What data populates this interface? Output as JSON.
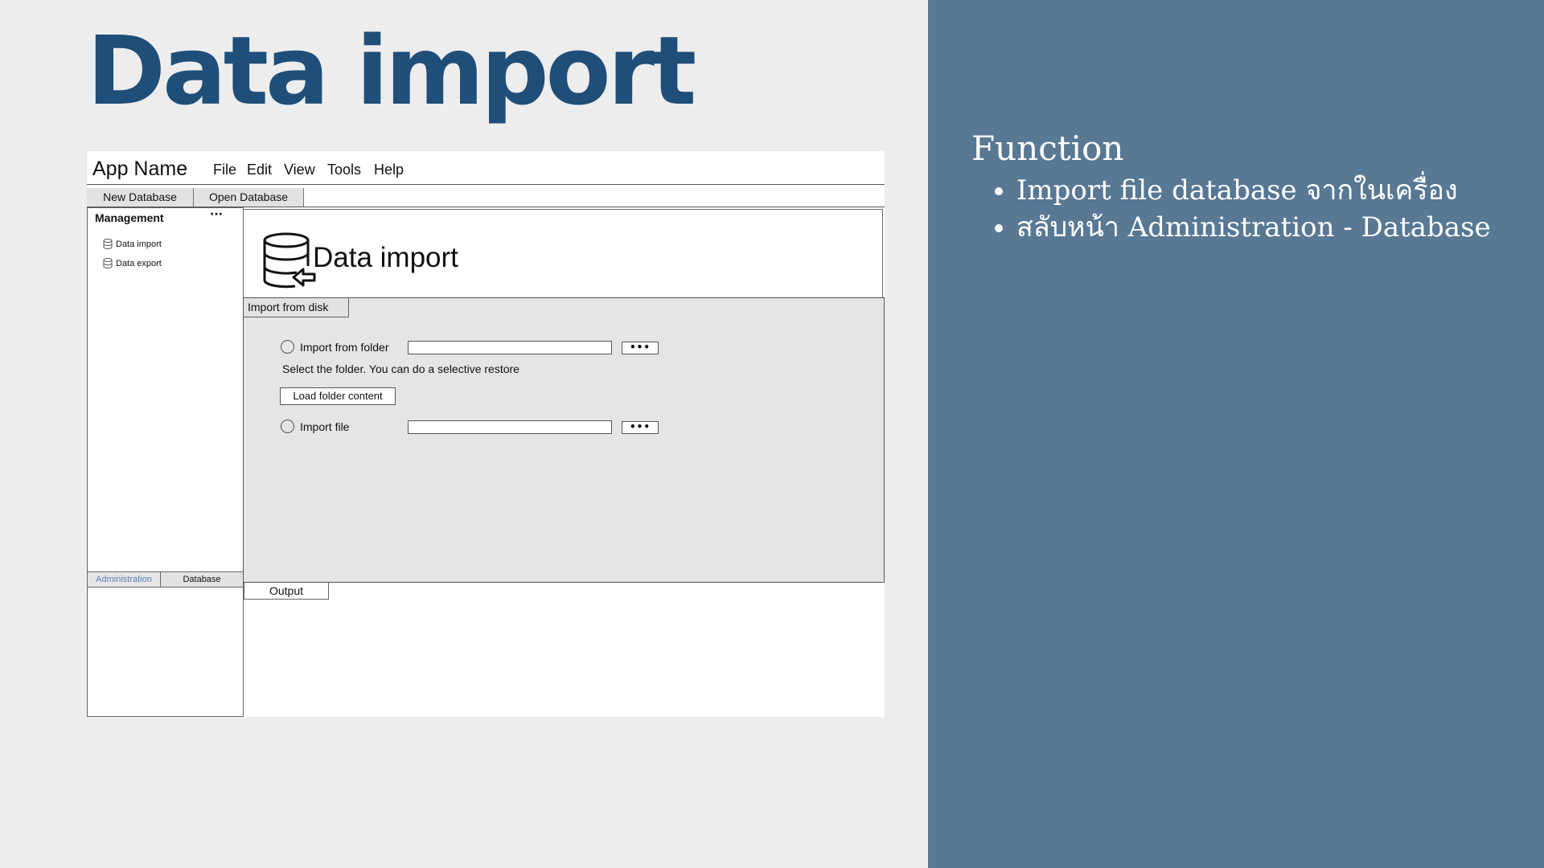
{
  "slide": {
    "title": "Data import",
    "function_title": "Function",
    "function_items": [
      "Import file database จากในเครื่อง",
      "สลับหน้า Administration - Database"
    ]
  },
  "app": {
    "name": "App Name",
    "menu": [
      "File",
      "Edit",
      "View",
      "Tools",
      "Help"
    ],
    "toolbar": [
      "New Database",
      "Open Database"
    ]
  },
  "sidebar": {
    "heading": "Management",
    "more": "···",
    "items": [
      {
        "label": "Data import",
        "icon": "database-icon"
      },
      {
        "label": "Data export",
        "icon": "database-icon"
      }
    ],
    "tabs": [
      "Administration",
      "Database"
    ],
    "active_tab_color": "#5b7fb5"
  },
  "content": {
    "title": "Data import",
    "icon": "database-import-icon",
    "tab": "Import from disk",
    "import_folder_label": "Import from folder",
    "import_folder_value": "",
    "folder_hint": "Select the folder. You can do a selective restore",
    "load_button": "Load folder content",
    "import_file_label": "Import file",
    "import_file_value": "",
    "browse_label": "•••",
    "output_tab": "Output"
  },
  "colors": {
    "title_blue": "#1f4e79",
    "panel_blue": "#587894"
  }
}
